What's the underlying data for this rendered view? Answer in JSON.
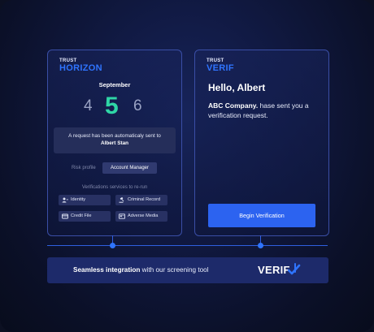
{
  "colors": {
    "accent": "#2f74ff",
    "highlight": "#2fd6a6",
    "button": "#2c63f0"
  },
  "left_card": {
    "brand_top": "TRUST",
    "brand_name": "HORIZON",
    "month": "September",
    "days": {
      "prev": "4",
      "current": "5",
      "next": "6"
    },
    "notice_text": "A request has been automaticaly sent to",
    "notice_name": "Albert Stan",
    "risk_label": "Risk profile",
    "risk_value": "Account Manager",
    "services_label": "Verifications services to re-run",
    "services": [
      {
        "label": "Identity",
        "icon": "id-user-icon"
      },
      {
        "label": "Criminal Record",
        "icon": "gavel-icon"
      },
      {
        "label": "Credit File",
        "icon": "credit-card-icon"
      },
      {
        "label": "Adverse Media",
        "icon": "media-icon"
      }
    ]
  },
  "right_card": {
    "brand_top": "TRUST",
    "brand_name": "VERIF",
    "greeting": "Hello, Albert",
    "company": "ABC Company.",
    "message": " hase sent you a verification request.",
    "cta": "Begin Verification"
  },
  "banner": {
    "text_bold": "Seamless integration",
    "text_rest": " with our screening tool",
    "logo": "VERIF",
    "logo_icon": "check-arrow-icon"
  }
}
